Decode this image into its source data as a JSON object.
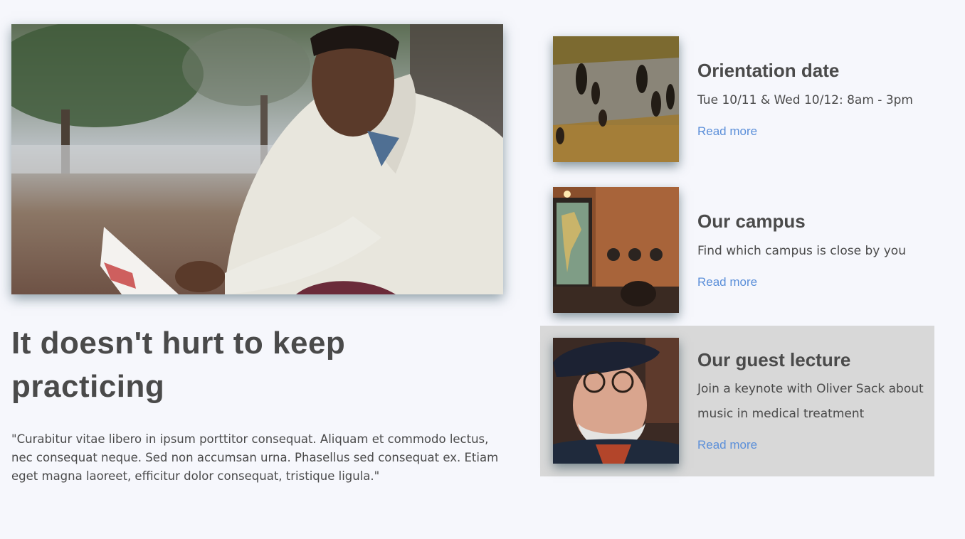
{
  "feature": {
    "headline": "It doesn't hurt to keep practicing",
    "quote": "\"Curabitur vitae libero in ipsum porttitor consequat. Aliquam et commodo lectus, nec consequat neque. Sed non accumsan urna. Phasellus sed consequat ex. Etiam eget magna laoreet, efficitur dolor consequat, tristique ligula.\""
  },
  "cards": [
    {
      "title": "Orientation date",
      "description": "Tue 10/11 & Wed 10/12: 8am - 3pm",
      "link": "Read more"
    },
    {
      "title": "Our campus",
      "description": "Find which campus is close by you",
      "link": "Read more"
    },
    {
      "title": "Our guest lecture",
      "description": "Join a keynote with Oliver Sack about music in medical treatment",
      "link": "Read more"
    }
  ],
  "colors": {
    "background": "#f6f7fc",
    "text": "#4a4a4a",
    "link": "#5b8fd9",
    "highlight": "#d8d8d8"
  }
}
